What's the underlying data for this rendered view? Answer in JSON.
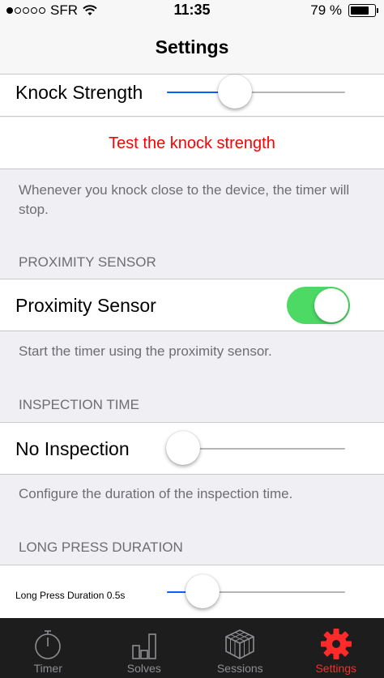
{
  "status_bar": {
    "carrier": "SFR",
    "time": "11:35",
    "battery": "79 %",
    "battery_level": 0.79,
    "signal_bars_filled": 1,
    "signal_bars_total": 5
  },
  "nav": {
    "title": "Settings"
  },
  "knock": {
    "label": "Knock Strength",
    "slider_value": 0.38,
    "test_label": "Test the knock strength",
    "footer": "Whenever you knock close to the device, the timer will stop."
  },
  "proximity": {
    "header": "PROXIMITY SENSOR",
    "label": "Proximity Sensor",
    "enabled": true,
    "footer": "Start the timer using the proximity sensor."
  },
  "inspection": {
    "header": "INSPECTION TIME",
    "label": "No Inspection",
    "slider_value": 0.0,
    "footer": "Configure the duration of the inspection time."
  },
  "long_press": {
    "header": "LONG PRESS DURATION",
    "label": "Long Press Duration 0.5s",
    "slider_value": 0.2
  },
  "tabs": [
    {
      "label": "Timer",
      "icon": "stopwatch-icon",
      "active": false
    },
    {
      "label": "Solves",
      "icon": "bar-chart-icon",
      "active": false
    },
    {
      "label": "Sessions",
      "icon": "cube-icon",
      "active": false
    },
    {
      "label": "Settings",
      "icon": "gear-icon",
      "active": true
    }
  ],
  "colors": {
    "accent_blue": "#0a60ff",
    "destructive_red": "#ff0000",
    "toggle_on": "#4cd964",
    "tab_active": "#ff2a2a",
    "tab_inactive": "#8e8e93"
  }
}
